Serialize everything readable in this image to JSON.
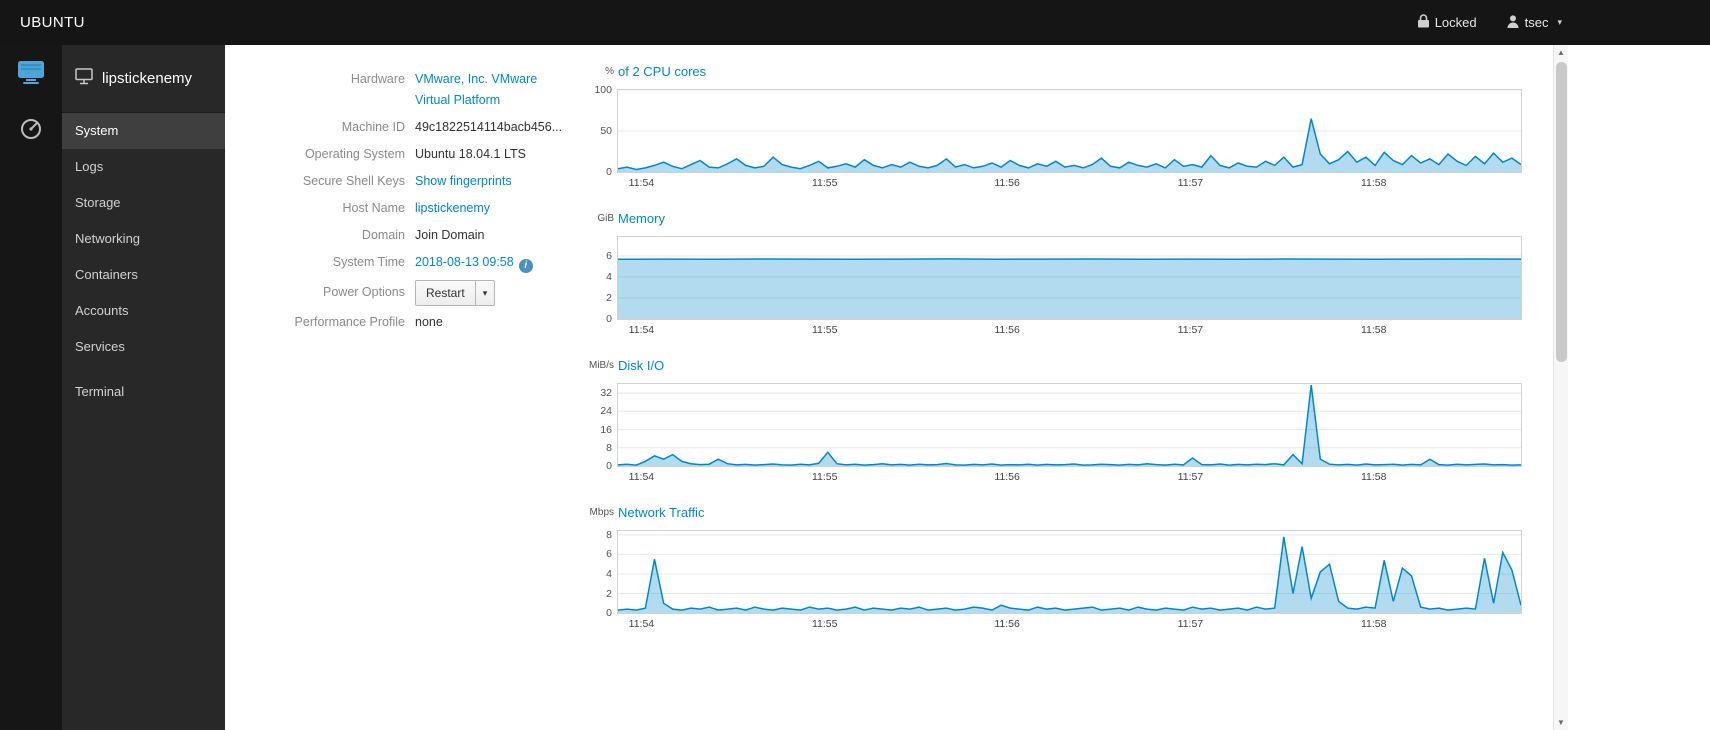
{
  "topbar": {
    "brand": "UBUNTU",
    "locked": "Locked",
    "user": "tsec"
  },
  "rail": {
    "machines_icon": "server-icon",
    "dashboard_icon": "gauge-icon"
  },
  "sidebar": {
    "hostname": "lipstickenemy",
    "items": [
      {
        "label": "System",
        "active": true
      },
      {
        "label": "Logs"
      },
      {
        "label": "Storage"
      },
      {
        "label": "Networking"
      },
      {
        "label": "Containers"
      },
      {
        "label": "Accounts"
      },
      {
        "label": "Services"
      }
    ],
    "terminal": "Terminal"
  },
  "info": {
    "hardware_label": "Hardware",
    "hardware_value1": "VMware, Inc. VMware",
    "hardware_value2": "Virtual Platform",
    "machine_id_label": "Machine ID",
    "machine_id_value": "49c1822514114bacb456...",
    "os_label": "Operating System",
    "os_value": "Ubuntu 18.04.1 LTS",
    "ssh_label": "Secure Shell Keys",
    "ssh_value": "Show fingerprints",
    "hostname_label": "Host Name",
    "hostname_value": "lipstickenemy",
    "domain_label": "Domain",
    "domain_value": "Join Domain",
    "time_label": "System Time",
    "time_value": "2018-08-13 09:58",
    "power_label": "Power Options",
    "power_value": "Restart",
    "profile_label": "Performance Profile",
    "profile_value": "none"
  },
  "colors": {
    "accent": "#0088ce",
    "chart_line": "#0088ce",
    "topbar_bg": "#151515",
    "sidebar_bg": "#282828"
  },
  "chart_data": [
    {
      "type": "area",
      "unit": "%",
      "title": "of 2 CPU cores",
      "ylim": [
        0,
        100
      ],
      "yticks": [
        0,
        50,
        100
      ],
      "xticks": [
        "11:54",
        "11:55",
        "11:56",
        "11:57",
        "11:58"
      ],
      "xtick_pos": [
        0.027,
        0.23,
        0.432,
        0.635,
        0.838
      ],
      "values": [
        4,
        6,
        3,
        5,
        8,
        12,
        7,
        4,
        9,
        14,
        6,
        5,
        10,
        16,
        8,
        5,
        7,
        18,
        9,
        6,
        4,
        8,
        13,
        5,
        7,
        10,
        6,
        15,
        8,
        5,
        9,
        6,
        12,
        7,
        5,
        8,
        16,
        6,
        9,
        5,
        7,
        11,
        6,
        14,
        8,
        5,
        10,
        7,
        13,
        6,
        8,
        5,
        9,
        17,
        7,
        5,
        12,
        8,
        6,
        10,
        5,
        15,
        7,
        9,
        6,
        20,
        8,
        5,
        11,
        7,
        6,
        13,
        8,
        18,
        6,
        9,
        65,
        22,
        10,
        15,
        25,
        12,
        18,
        8,
        24,
        14,
        9,
        20,
        11,
        16,
        9,
        22,
        13,
        8,
        19,
        10,
        23,
        12,
        17,
        9
      ]
    },
    {
      "type": "area",
      "unit": "GiB",
      "title": "Memory",
      "ylim": [
        0,
        7.8
      ],
      "yticks": [
        0,
        2,
        4,
        6
      ],
      "xticks": [
        "11:54",
        "11:55",
        "11:56",
        "11:57",
        "11:58"
      ],
      "xtick_pos": [
        0.027,
        0.23,
        0.432,
        0.635,
        0.838
      ],
      "values": [
        5.68,
        5.7,
        5.69,
        5.71,
        5.7,
        5.68,
        5.7,
        5.72,
        5.69,
        5.7,
        5.71,
        5.69,
        5.7,
        5.68,
        5.71,
        5.7,
        5.69,
        5.7,
        5.71,
        5.7
      ]
    },
    {
      "type": "area",
      "unit": "MiB/s",
      "title": "Disk I/O",
      "ylim": [
        0,
        36
      ],
      "yticks": [
        0,
        8,
        16,
        24,
        32
      ],
      "xticks": [
        "11:54",
        "11:55",
        "11:56",
        "11:57",
        "11:58"
      ],
      "xtick_pos": [
        0.027,
        0.23,
        0.432,
        0.635,
        0.838
      ],
      "values": [
        0.5,
        0.8,
        0.4,
        2,
        4.5,
        3,
        5,
        2,
        1,
        0.6,
        0.8,
        3,
        1,
        0.5,
        0.7,
        0.4,
        0.6,
        0.9,
        0.5,
        0.4,
        0.8,
        0.5,
        1.2,
        6,
        1,
        0.5,
        0.8,
        0.4,
        0.6,
        1,
        0.5,
        0.7,
        0.4,
        0.8,
        0.5,
        0.6,
        1.1,
        0.5,
        0.4,
        0.7,
        0.5,
        0.9,
        0.4,
        0.6,
        0.5,
        0.8,
        0.4,
        0.7,
        0.5,
        0.6,
        0.9,
        0.4,
        0.5,
        0.8,
        0.6,
        0.4,
        0.7,
        0.5,
        1,
        0.6,
        0.4,
        0.8,
        0.5,
        3.5,
        0.6,
        0.5,
        0.9,
        0.4,
        0.7,
        0.5,
        0.8,
        0.6,
        1,
        0.5,
        5,
        1,
        35.5,
        3,
        0.8,
        0.5,
        0.7,
        0.4,
        0.9,
        0.5,
        0.6,
        0.8,
        0.4,
        0.7,
        0.5,
        3,
        0.6,
        0.4,
        0.8,
        0.5,
        0.7,
        0.9,
        0.5,
        0.6,
        0.4,
        0.5
      ]
    },
    {
      "type": "area",
      "unit": "Mbps",
      "title": "Network Traffic",
      "ylim": [
        0,
        8.4
      ],
      "yticks": [
        0,
        2,
        4,
        6,
        8
      ],
      "xticks": [
        "11:54",
        "11:55",
        "11:56",
        "11:57",
        "11:58"
      ],
      "xtick_pos": [
        0.027,
        0.23,
        0.432,
        0.635,
        0.838
      ],
      "values": [
        0.3,
        0.4,
        0.3,
        0.5,
        5.5,
        1,
        0.4,
        0.3,
        0.5,
        0.4,
        0.6,
        0.3,
        0.4,
        0.5,
        0.3,
        0.6,
        0.4,
        0.3,
        0.5,
        0.4,
        0.3,
        0.6,
        0.4,
        0.5,
        0.3,
        0.4,
        0.6,
        0.3,
        0.5,
        0.4,
        0.3,
        0.5,
        0.4,
        0.6,
        0.3,
        0.4,
        0.5,
        0.3,
        0.4,
        0.6,
        0.5,
        0.3,
        0.8,
        0.5,
        0.4,
        0.3,
        0.6,
        0.4,
        0.5,
        0.3,
        0.4,
        0.5,
        0.6,
        0.3,
        0.4,
        0.5,
        0.3,
        0.6,
        0.4,
        0.3,
        0.5,
        0.4,
        0.3,
        0.6,
        0.4,
        0.5,
        0.3,
        0.4,
        0.5,
        0.3,
        0.6,
        0.4,
        0.5,
        7.8,
        2,
        6.8,
        1.5,
        4.2,
        5,
        1.2,
        0.5,
        0.4,
        0.6,
        0.5,
        5.4,
        1.2,
        4.6,
        3.8,
        0.6,
        0.4,
        0.5,
        0.3,
        0.4,
        0.5,
        0.4,
        5.6,
        1,
        6.2,
        4.4,
        0.8
      ]
    }
  ]
}
